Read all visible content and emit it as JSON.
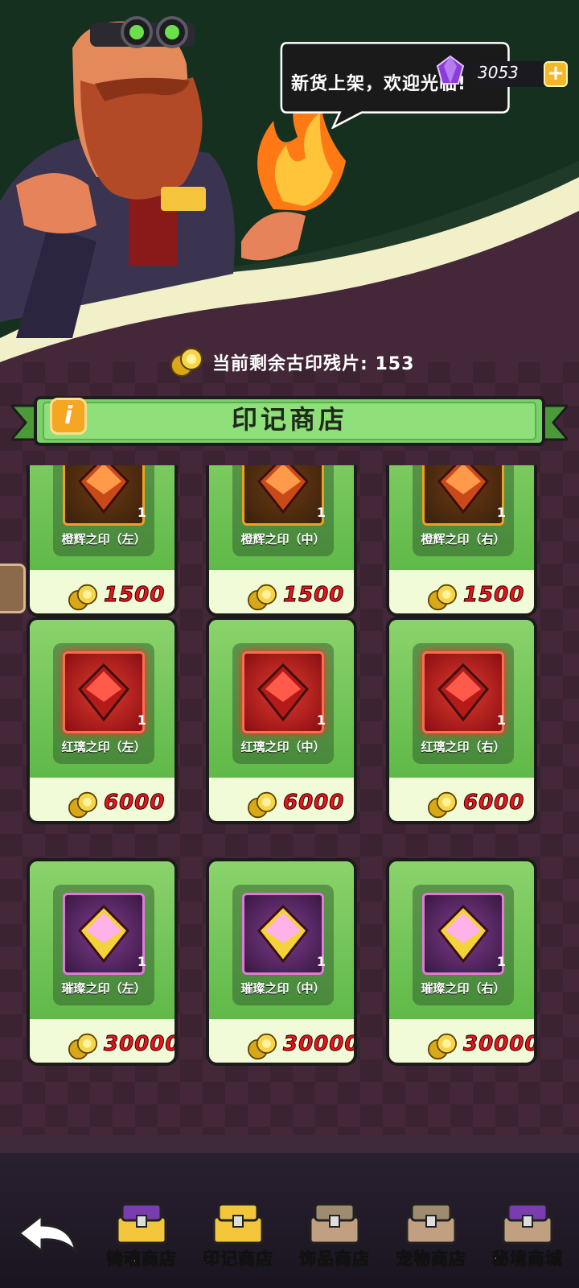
{
  "header": {
    "speech": "新货上架，欢迎光临!",
    "gems": "3053",
    "gem_add": "+"
  },
  "currency": {
    "label": "当前剩余古印残片: 153"
  },
  "shop": {
    "info": "i",
    "title": "印记商店"
  },
  "items": [
    {
      "name": "橙辉之印（左）",
      "qty": "1",
      "price": "1500",
      "tier": "orange"
    },
    {
      "name": "橙辉之印（中）",
      "qty": "1",
      "price": "1500",
      "tier": "orange"
    },
    {
      "name": "橙辉之印（右）",
      "qty": "1",
      "price": "1500",
      "tier": "orange"
    },
    {
      "name": "红璃之印（左）",
      "qty": "1",
      "price": "6000",
      "tier": "red"
    },
    {
      "name": "红璃之印（中）",
      "qty": "1",
      "price": "6000",
      "tier": "red"
    },
    {
      "name": "红璃之印（右）",
      "qty": "1",
      "price": "6000",
      "tier": "red"
    },
    {
      "name": "璀璨之印（左）",
      "qty": "1",
      "price": "30000",
      "tier": "purple"
    },
    {
      "name": "璀璨之印（中）",
      "qty": "1",
      "price": "30000",
      "tier": "purple"
    },
    {
      "name": "璀璨之印（右）",
      "qty": "1",
      "price": "30000",
      "tier": "purple"
    }
  ],
  "tabs": [
    {
      "label": "铸魂商店"
    },
    {
      "label": "印记商店"
    },
    {
      "label": "饰品商店"
    },
    {
      "label": "宠物商店"
    },
    {
      "label": "秘境商城"
    }
  ],
  "colors": {
    "accent_green": "#7ccf5a",
    "price_red": "#e8141c",
    "gem_purple": "#9b4de0"
  }
}
